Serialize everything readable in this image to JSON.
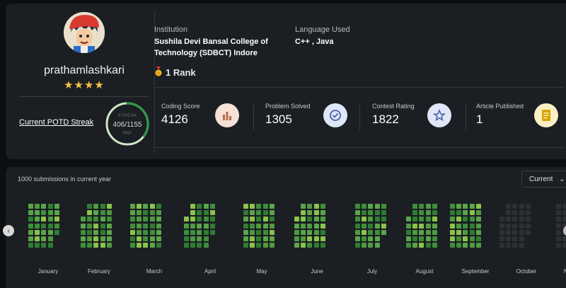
{
  "profile": {
    "username": "prathamlashkari",
    "stars": "★★★★",
    "potd_label": "Current POTD Streak",
    "streak": {
      "label": "STREAK",
      "value": "406/1155",
      "unit": "days",
      "progress": 0.35
    }
  },
  "institution": {
    "label": "Institution",
    "name_line1": "Sushila Devi Bansal College of",
    "name_line2": "Technology (SDBCT) Indore",
    "rank": "1 Rank"
  },
  "language": {
    "label": "Language Used",
    "value": "C++ , Java"
  },
  "stats": [
    {
      "label": "Coding Score",
      "value": "4126",
      "icon": "bar-chart-icon",
      "color": "#f6e1d6"
    },
    {
      "label": "Problem Solved",
      "value": "1305",
      "icon": "check-circle-icon",
      "color": "#dfe6f7"
    },
    {
      "label": "Contest Rating",
      "value": "1822",
      "icon": "star-badge-icon",
      "color": "#dfe6f7"
    },
    {
      "label": "Article Published",
      "value": "1",
      "icon": "document-icon",
      "color": "#fbefc4"
    }
  ],
  "heatmap": {
    "submissions_text": "1000 submissions in current year",
    "year_select": "Current",
    "months": [
      "January",
      "February",
      "March",
      "April",
      "May",
      "June",
      "July",
      "August",
      "September",
      "October",
      "No"
    ]
  },
  "colors": {
    "accent_green": "#5fbf5f",
    "cell_dark": "#2f7d32",
    "cell_light": "#8bc34a",
    "cell_empty": "#2c2f34"
  }
}
